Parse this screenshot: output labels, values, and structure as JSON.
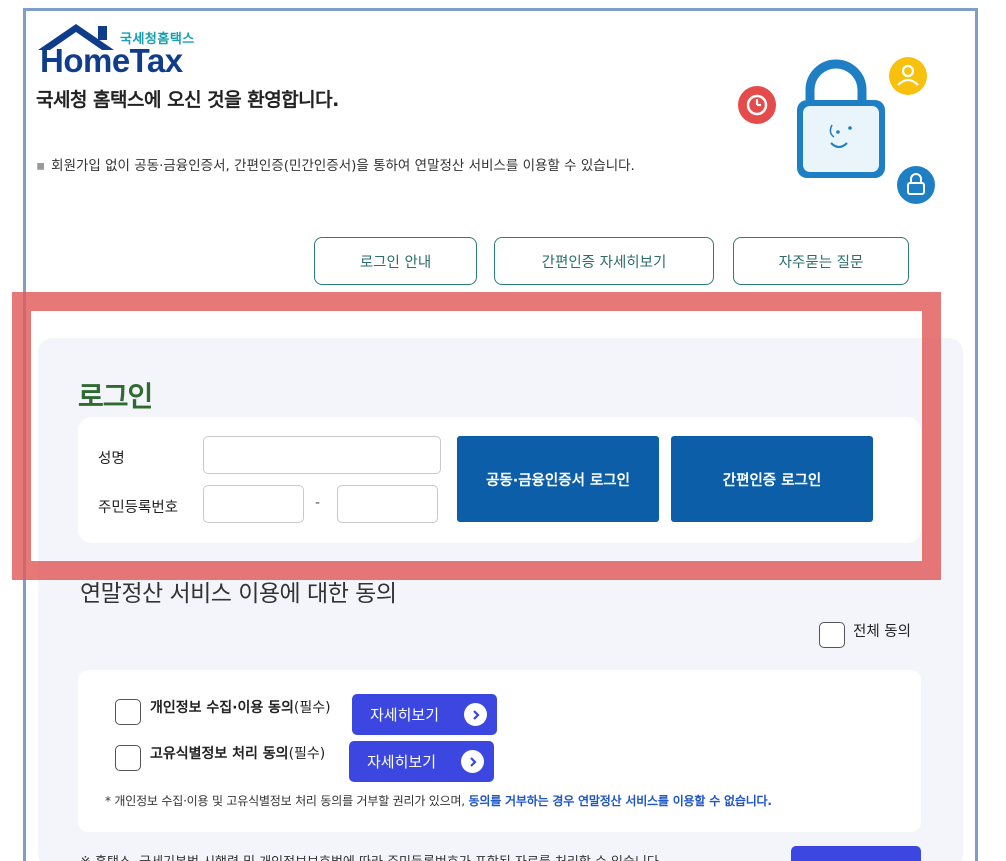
{
  "header": {
    "logo_sub": "국세청홈택스",
    "logo_main": "HomeTax",
    "welcome": "국세청 홈택스에 오신 것을 환영합니다.",
    "notice": "회원가입 없이 공동·금융인증서, 간편인증(민간인증서)을 통하여 연말정산 서비스를 이용할 수 있습니다."
  },
  "top_buttons": [
    {
      "label": "로그인 안내"
    },
    {
      "label": "간편인증 자세히보기"
    },
    {
      "label": "자주묻는 질문"
    }
  ],
  "login": {
    "title": "로그인",
    "name_label": "성명",
    "rrn_label": "주민등록번호",
    "name_value": "",
    "rrn_front_value": "",
    "rrn_back_value": "",
    "dash": "-",
    "cert_login": "공동·금융인증서 로그인",
    "simple_login": "간편인증 로그인"
  },
  "agreement": {
    "title": "연말정산 서비스 이용에 대한 동의",
    "all_agree": "전체 동의",
    "items": [
      {
        "label_bold": "개인정보 수집·이용 동의",
        "label_req": "(필수)",
        "detail": "자세히보기"
      },
      {
        "label_bold": "고유식별정보 처리 동의",
        "label_req": "(필수)",
        "detail": "자세히보기"
      }
    ],
    "fineprint_normal": "* 개인정보 수집·이용 및 고유식별정보 처리 동의를 거부할 권리가 있으며, ",
    "fineprint_highlight": "동의를 거부하는 경우 연말정산 서비스를 이용할 수 없습니다.",
    "bottom_text": "※ 홈택스, 국세기본법 시행령 및 개인정보보호법에 따라 주민등록번호가 포함된 자료를 처리할 수 있습니다."
  },
  "colors": {
    "accent_blue": "#0c5ea8",
    "detail_blue": "#3b47e0",
    "login_green": "#2f6b31",
    "highlight_red": "#e25a5a"
  }
}
